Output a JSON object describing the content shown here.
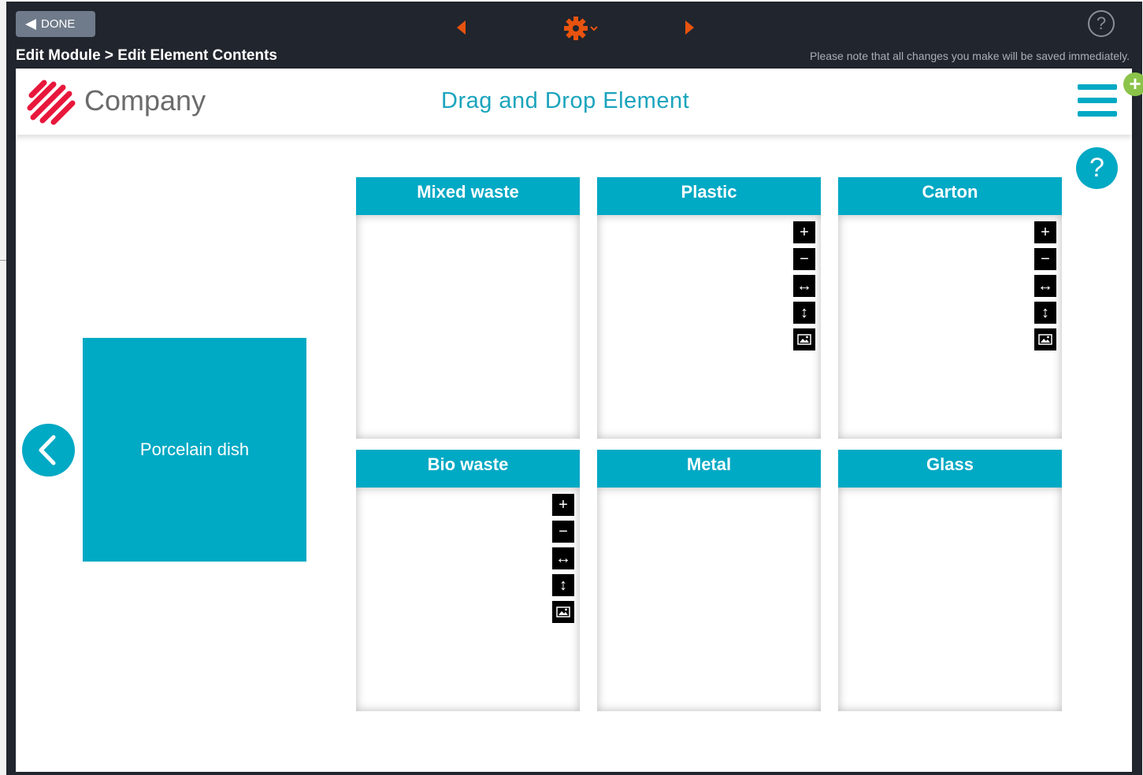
{
  "toolbar": {
    "done_label": "DONE",
    "help_label": "?",
    "breadcrumb": "Edit Module > Edit Element Contents",
    "save_note": "Please note that all changes you make will be saved immediately."
  },
  "colors": {
    "accent": "#00a9c4",
    "nav_arrow": "#e8530e",
    "logo": "#e8173c",
    "add_bubble": "#8bc34a"
  },
  "header": {
    "logo_text": "Company",
    "title": "Drag and Drop Element",
    "help_label": "?"
  },
  "drag_item": {
    "label": "Porcelain dish"
  },
  "bins": [
    {
      "label": "Mixed waste",
      "has_tools": false
    },
    {
      "label": "Plastic",
      "has_tools": true
    },
    {
      "label": "Carton",
      "has_tools": true
    },
    {
      "label": "Bio waste",
      "has_tools": true
    },
    {
      "label": "Metal",
      "has_tools": false
    },
    {
      "label": "Glass",
      "has_tools": false
    }
  ],
  "tool_icons": [
    "plus-icon",
    "minus-icon",
    "resize-horizontal-icon",
    "resize-vertical-icon",
    "image-icon"
  ]
}
